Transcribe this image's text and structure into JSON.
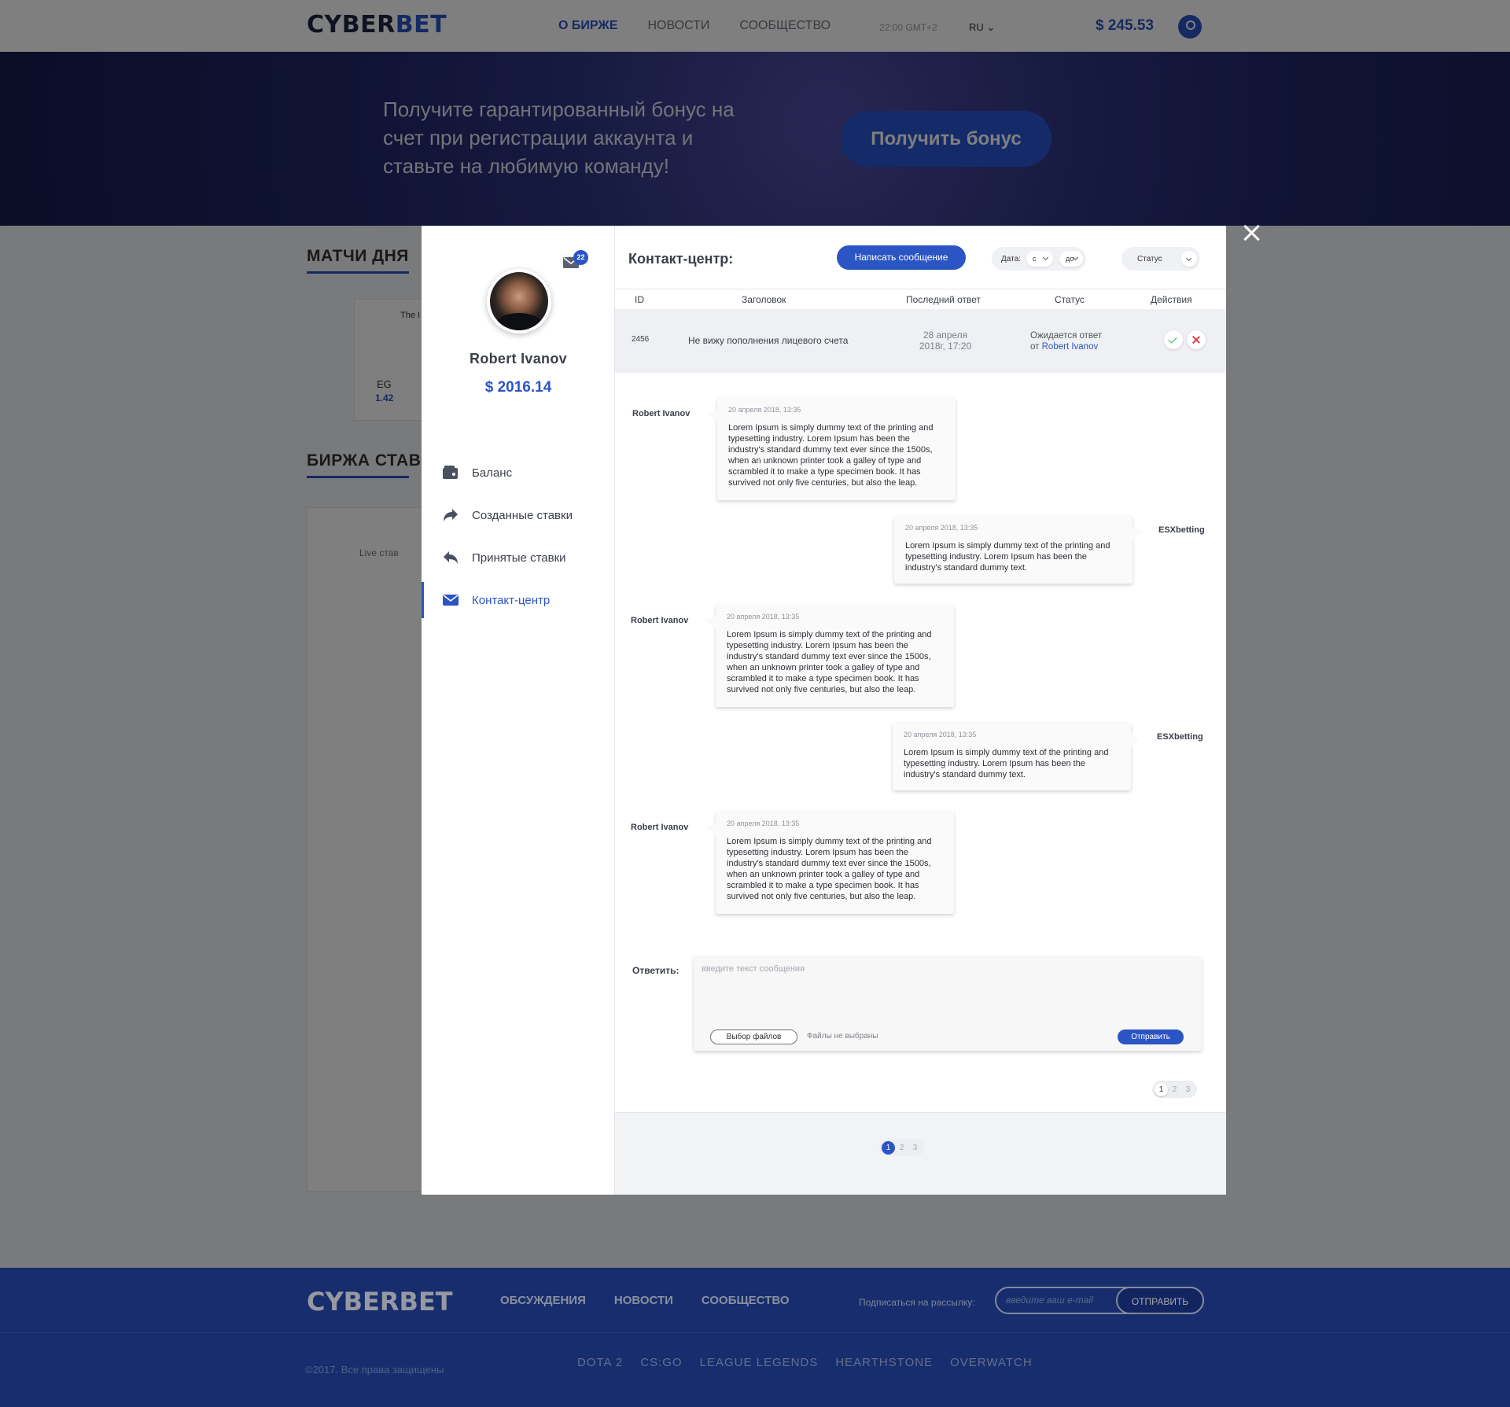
{
  "header": {
    "logo_main": "CYBER",
    "logo_accent": "BET",
    "nav": [
      "О БИРЖЕ",
      "НОВОСТИ",
      "СООБЩЕСТВО"
    ],
    "time": "22:00 GMT+2",
    "lang": "RU",
    "balance": "$ 245.53"
  },
  "banner": {
    "text": "Получите гарантированный бонус на счет при регистрации аккаунта и ставьте на любимую команду!",
    "button": "Получить бонус"
  },
  "page": {
    "matches_title": "МАТЧИ ДНЯ",
    "exchange_title": "БИРЖА СТАВОК",
    "match_card": {
      "event": "The I",
      "team": "EG",
      "odds": "1.42"
    },
    "live_tab": "Live став"
  },
  "profile": {
    "unread": "22",
    "name": "Robert Ivanov",
    "balance": "$ 2016.14"
  },
  "menu": [
    {
      "label": "Баланс",
      "icon": "wallet-icon"
    },
    {
      "label": "Созданные ставки",
      "icon": "share-icon"
    },
    {
      "label": "Принятые ставки",
      "icon": "reply-icon"
    },
    {
      "label": "Контакт-центр",
      "icon": "envelope-icon",
      "active": true
    }
  ],
  "contact_center": {
    "title": "Контакт-центр:",
    "write_button": "Написать сообщение",
    "date_label": "Дата:",
    "date_from": "с",
    "date_to": "до",
    "status_filter": "Статус",
    "columns": [
      "ID",
      "Заголовок",
      "Последний ответ",
      "Статус",
      "Действия"
    ],
    "ticket": {
      "id": "2456",
      "title": "Не вижу пополнения лицевого счета",
      "date_line1": "28 апреля",
      "date_line2": "2018г, 17:20",
      "status_line1": "Ожидается ответ",
      "status_prefix": "от",
      "status_user": "Robert Ivanov"
    }
  },
  "messages": [
    {
      "author": "Robert Ivanov",
      "time": "20 апреля 2018, 13:35",
      "text": "Lorem Ipsum is simply dummy text of the printing and typesetting industry. Lorem Ipsum has been the industry's standard dummy text ever since the 1500s, when an unknown printer took a galley of type and scrambled it to make a type specimen book. It has survived not only five centuries, but also the leap.",
      "side": "left"
    },
    {
      "author": "ESXbetting",
      "time": "20 апреля 2018, 13:35",
      "text": "Lorem Ipsum is simply dummy text of the printing and typesetting industry. Lorem Ipsum has been the industry's standard dummy text.",
      "side": "right"
    },
    {
      "author": "Robert Ivanov",
      "time": "20 апреля 2018, 13:35",
      "text": "Lorem Ipsum is simply dummy text of the printing and typesetting industry. Lorem Ipsum has been the industry's standard dummy text ever since the 1500s, when an unknown printer took a galley of type and scrambled it to make a type specimen book. It has survived not only five centuries, but also the leap.",
      "side": "left"
    },
    {
      "author": "ESXbetting",
      "time": "20 апреля 2018, 13:35",
      "text": "Lorem Ipsum is simply dummy text of the printing and typesetting industry. Lorem Ipsum has been the industry's standard dummy text.",
      "side": "right"
    },
    {
      "author": "Robert Ivanov",
      "time": "20 апреля 2018, 13:35",
      "text": "Lorem Ipsum is simply dummy text of the printing and typesetting industry. Lorem Ipsum has been the industry's standard dummy text ever since the 1500s, when an unknown printer took a galley of type and scrambled it to make a type specimen book. It has survived not only five centuries, but also the leap.",
      "side": "left"
    }
  ],
  "reply": {
    "label": "Ответить:",
    "placeholder": "введите текст сообщения",
    "file_button": "Выбор файлов",
    "no_file": "Файлы не выбраны",
    "send": "Отправить"
  },
  "pagination": {
    "pages": [
      "1",
      "2",
      "3"
    ],
    "current": "1"
  },
  "footer": {
    "logo": "CYBERBET",
    "nav": [
      "ОБСУЖДЕНИЯ",
      "НОВОСТИ",
      "СООБЩЕСТВО"
    ],
    "subscribe_label": "Подписаться на рассылку:",
    "email_placeholder": "введите ваш e-mail",
    "subscribe_button": "ОТПРАВИТЬ",
    "copyright": "©2017. Все права защищены",
    "games": [
      "DOTA 2",
      "CS:GO",
      "LEAGUE LEGENDS",
      "HEARTHSTONE",
      "OVERWATCH"
    ]
  },
  "colors": {
    "accent": "#2b55c4",
    "success": "#35b54a",
    "danger": "#e23c3c"
  }
}
